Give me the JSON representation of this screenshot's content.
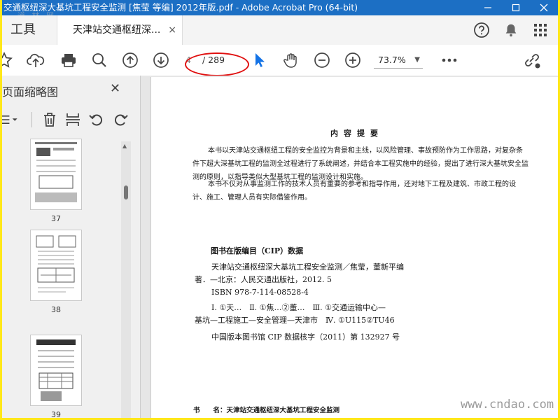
{
  "window": {
    "title": "交通枢纽深大基坑工程安全监测 [焦莹 等编] 2012年版.pdf - Adobe Acrobat Pro (64-bit)",
    "watermark_top": "道 林 网"
  },
  "tabs": {
    "tools_label": "工具",
    "document_label": "天津站交通枢纽深...",
    "close_glyph": "×"
  },
  "toolbar": {
    "current_page": "4",
    "total_pages": "/ 289",
    "zoom": "73.7%",
    "zoom_caret": "▼"
  },
  "sidebar": {
    "title": "页面缩略图",
    "close_glyph": "✕",
    "thumbnails": [
      {
        "page": "37"
      },
      {
        "page": "38"
      },
      {
        "page": "39"
      }
    ]
  },
  "page": {
    "abstract_title": "内容提要",
    "abstract_p1": "本书以天津站交通枢纽工程的安全监控为背景和主线，以风险管理、事故预防作为工作思路，对复杂条件下超大深基坑工程的监测全过程进行了系统阐述，并结合本工程实施中的经验，提出了进行深大基坑安全监测的原则，以指导类似大型基坑工程的监测设计和实施。",
    "abstract_p2": "本书不仅对从事监测工作的技术人员有重要的参考和指导作用，还对地下工程及建筑、市政工程的设计、施工、管理人员有实际借鉴作用。",
    "cip_heading": "图书在版编目（CIP）数据",
    "cip_line1": "天津站交通枢纽深大基坑工程安全监测／焦莹，董新平编",
    "cip_line2": "著．—北京：人民交通出版社，2012. 5",
    "cip_isbn": "ISBN 978-7-114-08528-4",
    "cip_line3": "Ⅰ. ①天…　Ⅱ. ①焦…②董…　Ⅲ. ①交通运输中心—",
    "cip_line4": "基坑—工程施工—安全管理—天津市　Ⅳ. ①U115②TU46",
    "cip_line5": "中国版本图书馆 CIP 数据核字（2011）第 132927 号",
    "footer": "书　　名：天津站交通枢纽深大基坑工程安全监测"
  },
  "watermark_bottom": "www.cndao.com",
  "colors": {
    "title_bar": "#1c6fc4",
    "accent_blue": "#1473e6",
    "annotation_red": "#e01010",
    "outer_frame": "#ffe81a"
  }
}
